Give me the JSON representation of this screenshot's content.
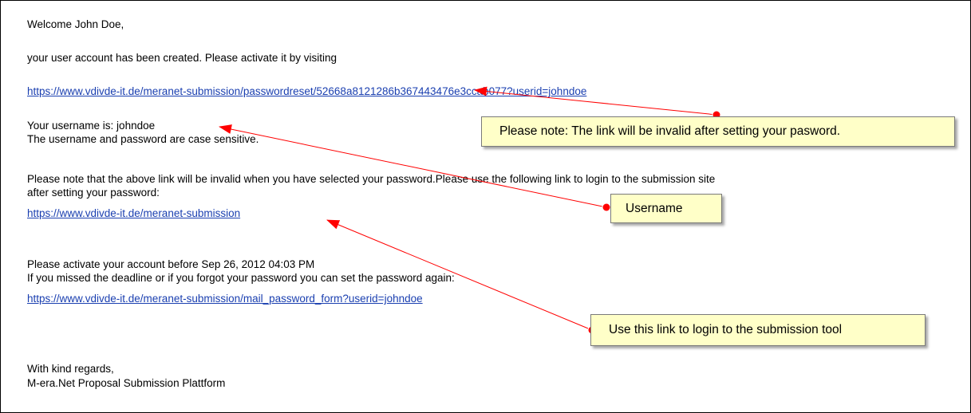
{
  "email": {
    "greeting": "Welcome John Doe,",
    "line_created": "your user account has been created. Please activate it by visiting",
    "reset_link": "https://www.vdivde-it.de/meranet-submission/passwordreset/52668a8121286b367443476e3ccab077?userid=johndoe",
    "username_line": "Your username is: johndoe",
    "case_line": "The username and password are case sensitive.",
    "note_line1": "Please note that the above link will be invalid when you have selected your password.Please use the following link to login to the submission site",
    "note_line2": "after setting your password:",
    "login_link": "https://www.vdivde-it.de/meranet-submission",
    "activate_line": "Please activate your account before Sep 26, 2012 04:03 PM",
    "missed_line": "If you missed the deadline or if you forgot your password you can set the password again:",
    "mail_form_link": "https://www.vdivde-it.de/meranet-submission/mail_password_form?userid=johndoe",
    "regards": "With kind regards,",
    "signature": "M-era.Net Proposal Submission Plattform"
  },
  "callouts": {
    "link_note": "Please note: The link will be invalid after setting your pasword.",
    "username": "Username",
    "login_tool": "Use this link to login to the submission tool"
  },
  "colors": {
    "link": "#1a3fb0",
    "callout_bg": "#ffffc8",
    "arrow": "#ff0000"
  }
}
